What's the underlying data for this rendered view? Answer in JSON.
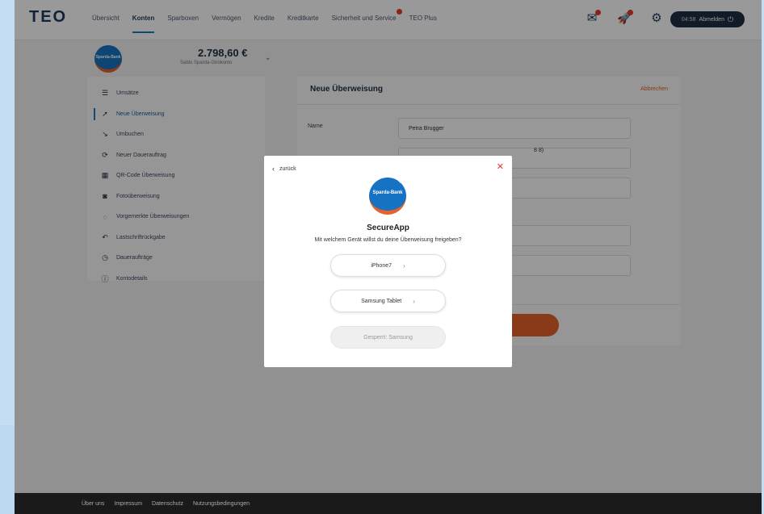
{
  "header": {
    "logo": "TEO",
    "nav": [
      {
        "label": "Übersicht",
        "active": false,
        "badge": false
      },
      {
        "label": "Konten",
        "active": true,
        "badge": false
      },
      {
        "label": "Sparboxen",
        "active": false,
        "badge": false
      },
      {
        "label": "Vermögen",
        "active": false,
        "badge": false
      },
      {
        "label": "Kredite",
        "active": false,
        "badge": false
      },
      {
        "label": "Kreditkarte",
        "active": false,
        "badge": false
      },
      {
        "label": "Sicherheit und Service",
        "active": false,
        "badge": true
      },
      {
        "label": "TEO Plus",
        "active": false,
        "badge": false
      }
    ],
    "icons": [
      "mailbox-icon",
      "rocket-icon",
      "gear-icon"
    ],
    "logout": {
      "time": "04:58",
      "label": "Abmelden"
    }
  },
  "account": {
    "bank_logo": "Sparda-Bank",
    "balance": "2.798,60 €",
    "subtitle": "Saldo Sparda-Girokonto"
  },
  "menu": [
    {
      "label": "Umsätze",
      "icon": "list-icon",
      "glyph": "☰",
      "active": false
    },
    {
      "label": "Neue Überweisung",
      "icon": "transfer-icon",
      "glyph": "➚",
      "active": true
    },
    {
      "label": "Umbuchen",
      "icon": "rebook-icon",
      "glyph": "↘",
      "active": false
    },
    {
      "label": "Neuer Dauerauftrag",
      "icon": "recurring-icon",
      "glyph": "⟳",
      "active": false
    },
    {
      "label": "QR-Code Überweisung",
      "icon": "qr-code-icon",
      "glyph": "▦",
      "active": false
    },
    {
      "label": "Fotoüberweisung",
      "icon": "camera-icon",
      "glyph": "◙",
      "active": false
    },
    {
      "label": "Vorgemerkte Überweisungen",
      "icon": "scheduled-icon",
      "glyph": "◌",
      "active": false
    },
    {
      "label": "Lastschriftrückgabe",
      "icon": "return-icon",
      "glyph": "↶",
      "active": false
    },
    {
      "label": "Daueraufträge",
      "icon": "clock-icon",
      "glyph": "◷",
      "active": false
    },
    {
      "label": "Kontodetails",
      "icon": "info-icon",
      "glyph": "ⓘ",
      "active": false
    }
  ],
  "form": {
    "title": "Neue Überweisung",
    "cancel": "Abbrechen",
    "name_label": "Name",
    "name_value": "Petra Brugger",
    "partial_text": "8 8)"
  },
  "footer": [
    "Über uns",
    "Impressum",
    "Datenschutz",
    "Nutzungsbedingungen"
  ],
  "modal": {
    "back": "zurück",
    "logo": "Sparda-Bank",
    "title": "SecureApp",
    "question": "Mit welchem Gerät willst du deine Überweisung freigeben?",
    "devices": [
      {
        "label": "iPhone7",
        "disabled": false
      },
      {
        "label": "Samsung Tablet",
        "disabled": false
      },
      {
        "label": "Gesperrt: Samsung",
        "disabled": true
      }
    ]
  },
  "colors": {
    "accent": "#1a7fc1",
    "brand_orange": "#e5632a",
    "navy": "#1f2f45",
    "badge_red": "#e43b2c"
  }
}
